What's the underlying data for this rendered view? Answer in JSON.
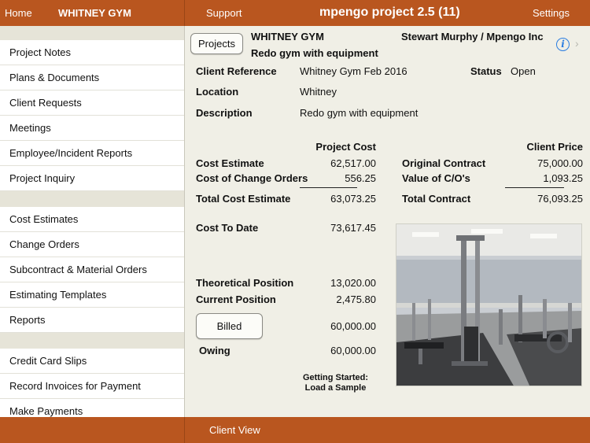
{
  "topbar": {
    "home": "Home",
    "project_name": "WHITNEY GYM",
    "support": "Support",
    "app_title": "mpengo project 2.5 (11)",
    "settings": "Settings"
  },
  "sidebar": {
    "group1": [
      "Project Notes",
      "Plans & Documents",
      "Client Requests",
      "Meetings",
      "Employee/Incident Reports",
      "Project Inquiry"
    ],
    "group2": [
      "Cost Estimates",
      "Change Orders",
      "Subcontract & Material Orders",
      "Estimating Templates",
      "Reports"
    ],
    "group3": [
      "Credit Card Slips",
      "Record Invoices for Payment",
      "Make Payments"
    ]
  },
  "header": {
    "projects_button": "Projects",
    "project_name": "WHITNEY GYM",
    "client": "Stewart Murphy / Mpengo Inc",
    "subtitle": "Redo gym with equipment"
  },
  "details": {
    "client_reference_label": "Client Reference",
    "client_reference_value": "Whitney Gym Feb 2016",
    "status_label": "Status",
    "status_value": "Open",
    "location_label": "Location",
    "location_value": "Whitney",
    "description_label": "Description",
    "description_value": "Redo gym with equipment"
  },
  "costs": {
    "project_cost_header": "Project Cost",
    "client_price_header": "Client Price",
    "cost_estimate_label": "Cost Estimate",
    "cost_estimate_value": "62,517.00",
    "change_orders_label": "Cost of Change Orders",
    "change_orders_value": "556.25",
    "total_cost_label": "Total Cost Estimate",
    "total_cost_value": "63,073.25",
    "original_contract_label": "Original Contract",
    "original_contract_value": "75,000.00",
    "value_co_label": "Value of C/O's",
    "value_co_value": "1,093.25",
    "total_contract_label": "Total Contract",
    "total_contract_value": "76,093.25",
    "cost_to_date_label": "Cost To Date",
    "cost_to_date_value": "73,617.45",
    "theoretical_label": "Theoretical Position",
    "theoretical_value": "13,020.00",
    "current_label": "Current Position",
    "current_value": "2,475.80",
    "billed_button": "Billed",
    "billed_value": "60,000.00",
    "owing_label": "Owing",
    "owing_value": "60,000.00",
    "getting_started_line1": "Getting Started:",
    "getting_started_line2": "Load a Sample"
  },
  "bottombar": {
    "client_view": "Client View"
  },
  "colors": {
    "accent": "#b9561f",
    "info": "#2a7de1"
  }
}
